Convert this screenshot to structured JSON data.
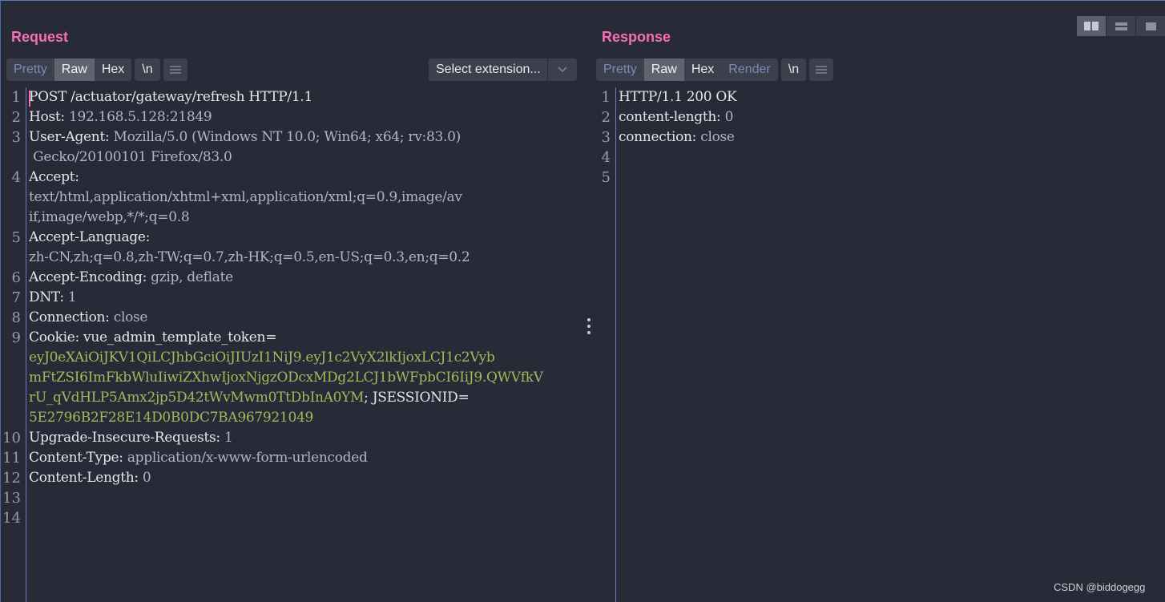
{
  "layout_toggles": [
    {
      "icon": "split-horizontal-icon",
      "active": true
    },
    {
      "icon": "split-vertical-icon",
      "active": false
    },
    {
      "icon": "single-pane-icon",
      "active": false
    }
  ],
  "request": {
    "title": "Request",
    "tabs": {
      "pretty": "Pretty",
      "raw": "Raw",
      "hex": "Hex",
      "newline": "\\n"
    },
    "active_tab": "Raw",
    "extension_select": "Select extension...",
    "line_numbers": [
      "1",
      "2",
      "3",
      "4",
      "5",
      "6",
      "7",
      "8",
      "9",
      "10",
      "11",
      "12",
      "13",
      "14"
    ],
    "lines": {
      "l1": "POST /actuator/gateway/refresh HTTP/1.1",
      "l2_key": "Host: ",
      "l2_val": "192.168.5.128:21849",
      "l3_key": "User-Agent: ",
      "l3_val": "Mozilla/5.0 (Windows NT 10.0; Win64; x64; rv:83.0)",
      "l3_cont": " Gecko/20100101 Firefox/83.0",
      "l4_key": "Accept:",
      "l4_val_a": "text/html,application/xhtml+xml,application/xml;q=0.9,image/av",
      "l4_val_b": "if,image/webp,*/*;q=0.8",
      "l5_key": "Accept-Language:",
      "l5_val": "zh-CN,zh;q=0.8,zh-TW;q=0.7,zh-HK;q=0.5,en-US;q=0.3,en;q=0.2",
      "l6_key": "Accept-Encoding: ",
      "l6_val": "gzip, deflate",
      "l7_key": "DNT: ",
      "l7_val": "1",
      "l8_key": "Connection: ",
      "l8_val": "close",
      "l9_key": "Cookie: ",
      "l9_name": "vue_admin_template_token=",
      "l9_tok_a": "eyJ0eXAiOiJKV1QiLCJhbGciOiJIUzI1NiJ9.eyJ1c2VyX2lkIjoxLCJ1c2Vyb",
      "l9_tok_b": "mFtZSI6ImFkbWluIiwiZXhwIjoxNjgzODcxMDg2LCJ1bWFpbCI6IiJ9.QWVfkV",
      "l9_tok_c": "rU_qVdHLP5Amx2jp5D42tWvMwm0TtDbInA0YM",
      "l9_sess_name": "; JSESSIONID=",
      "l9_sess_val": "5E2796B2F28E14D0B0DC7BA967921049",
      "l10_key": "Upgrade-Insecure-Requests: ",
      "l10_val": "1",
      "l11_key": "Content-Type: ",
      "l11_val": "application/x-www-form-urlencoded",
      "l12_key": "Content-Length: ",
      "l12_val": "0"
    }
  },
  "response": {
    "title": "Response",
    "tabs": {
      "pretty": "Pretty",
      "raw": "Raw",
      "hex": "Hex",
      "render": "Render",
      "newline": "\\n"
    },
    "active_tab": "Raw",
    "line_numbers": [
      "1",
      "2",
      "3",
      "4",
      "5"
    ],
    "lines": {
      "l1": "HTTP/1.1 200 OK",
      "l2_key": "content-length: ",
      "l2_val": "0",
      "l3_key": "connection: ",
      "l3_val": "close"
    }
  },
  "watermark": "CSDN @biddogegg",
  "colors": {
    "background": "#282a37",
    "title": "#f56fb6",
    "cookie_value": "#a4b85a",
    "gutter_border": "#6e7bc8"
  }
}
